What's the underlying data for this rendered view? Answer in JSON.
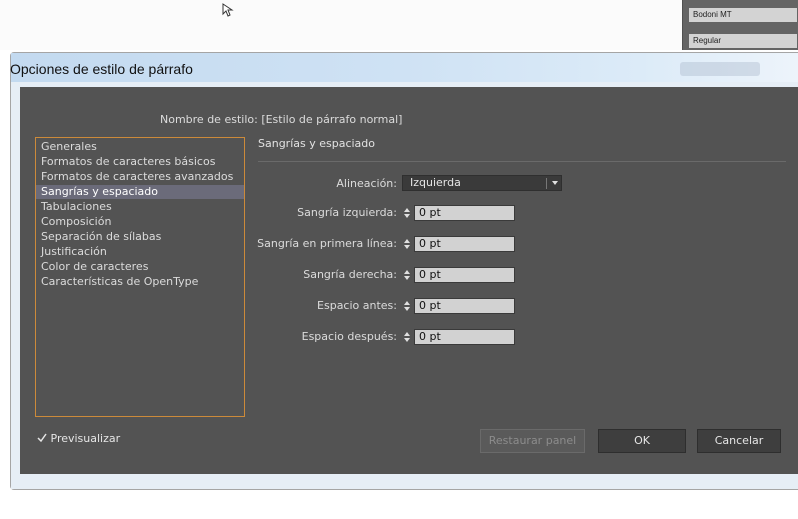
{
  "background": {
    "font_panel": {
      "font_family": "Bodoni MT",
      "font_style": "Regular"
    }
  },
  "window": {
    "title": "Opciones de estilo de párrafo"
  },
  "style_name": {
    "label": "Nombre de estilo:",
    "value": "[Estilo de párrafo normal]"
  },
  "categories": [
    "Generales",
    "Formatos de caracteres básicos",
    "Formatos de caracteres avanzados",
    "Sangrías y espaciado",
    "Tabulaciones",
    "Composición",
    "Separación de sílabas",
    "Justificación",
    "Color de caracteres",
    "Características de OpenType"
  ],
  "selected_category": "Sangrías y espaciado",
  "section": {
    "title": "Sangrías y espaciado",
    "alignment": {
      "label": "Alineación:",
      "value": "Izquierda"
    },
    "fields": [
      {
        "label": "Sangría izquierda:",
        "value": "0 pt"
      },
      {
        "label": "Sangría en primera línea:",
        "value": "0 pt"
      },
      {
        "label": "Sangría derecha:",
        "value": "0 pt"
      },
      {
        "label": "Espacio antes:",
        "value": "0 pt"
      },
      {
        "label": "Espacio después:",
        "value": "0 pt"
      }
    ]
  },
  "footer": {
    "preview_checkbox": {
      "checked": true,
      "label": "Previsualizar"
    },
    "restore_button": "Restaurar panel",
    "ok_button": "OK",
    "cancel_button": "Cancelar"
  },
  "colors": {
    "dialog_bg": "#535353",
    "selection": "#6b6b7a",
    "list_border": "#cc8a3a",
    "titlebar": "#c8ddf2"
  }
}
